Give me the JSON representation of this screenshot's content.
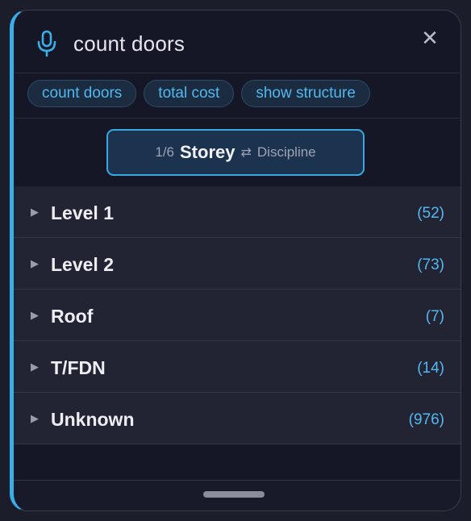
{
  "search": {
    "icon": "microphone-icon",
    "query": "count doors",
    "close_icon": "close-icon",
    "close_glyph": "✕"
  },
  "suggestions": [
    "count doors",
    "total cost",
    "show structure"
  ],
  "grouping": {
    "position": "1/6",
    "current": "Storey",
    "swap_icon": "⇄",
    "alternative": "Discipline"
  },
  "groups": [
    {
      "label": "Level 1",
      "count": "(52)"
    },
    {
      "label": "Level 2",
      "count": "(73)"
    },
    {
      "label": "Roof",
      "count": "(7)"
    },
    {
      "label": "T/FDN",
      "count": "(14)"
    },
    {
      "label": "Unknown",
      "count": "(976)"
    }
  ],
  "colors": {
    "accent": "#3aaee8",
    "background": "#151727",
    "row": "#232433"
  }
}
